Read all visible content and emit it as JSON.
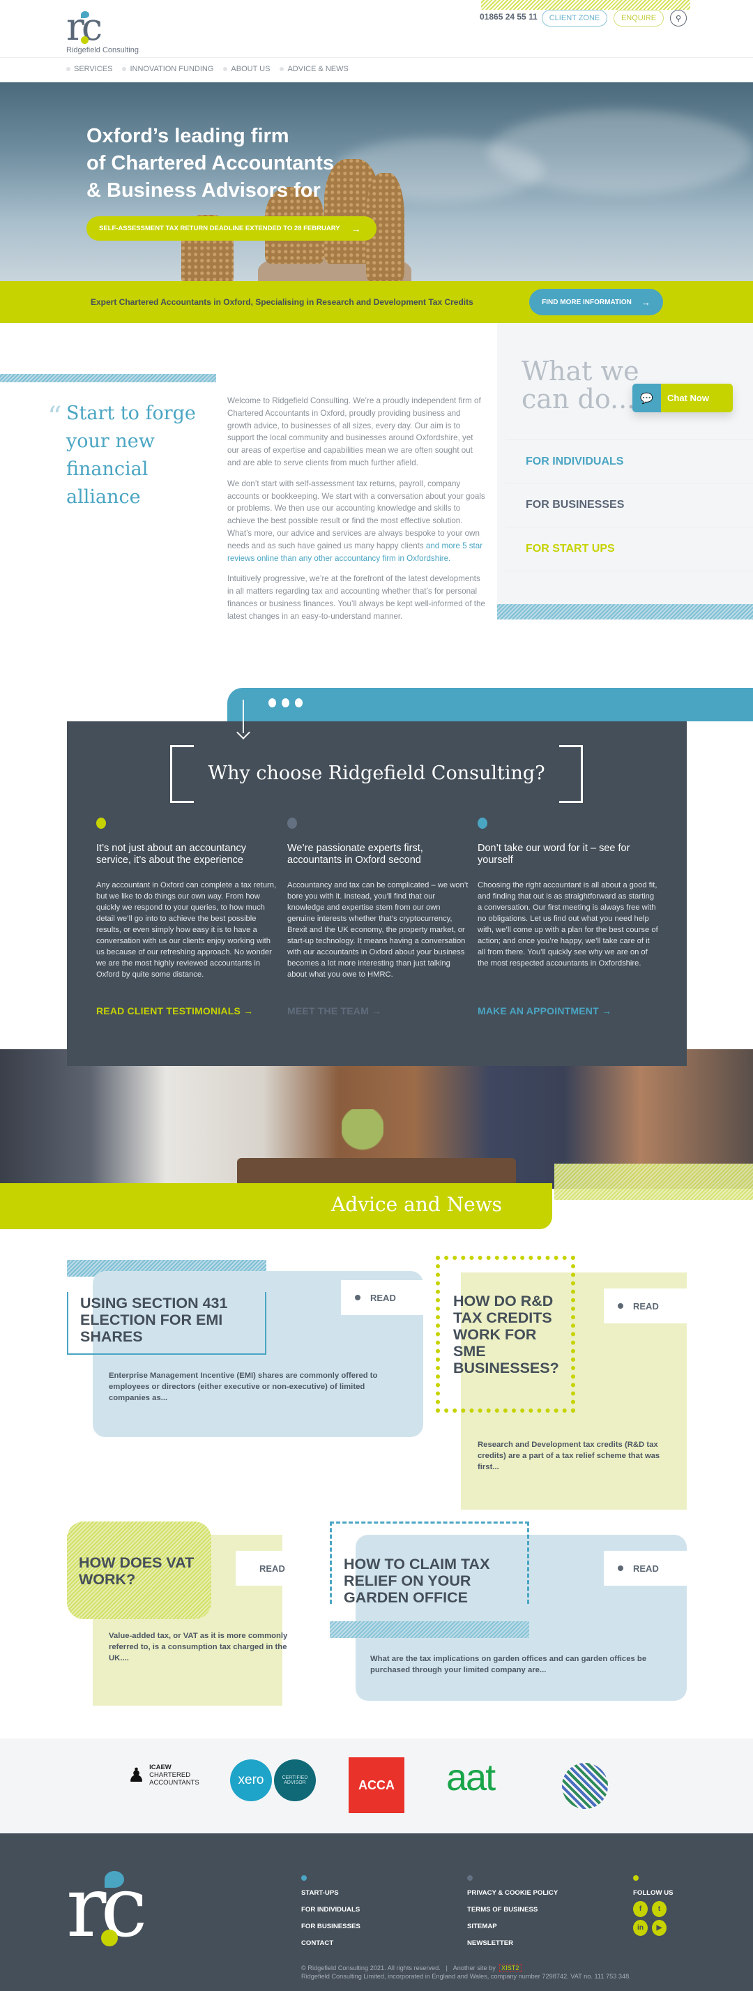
{
  "header": {
    "logo_text": "Ridgefield Consulting",
    "logo_mark": "rc",
    "phone": "01865 24 55 11",
    "client_zone": "CLIENT ZONE",
    "enquire": "ENQUIRE",
    "search_icon": "search-icon"
  },
  "nav": [
    {
      "label": "SERVICES"
    },
    {
      "label": "INNOVATION FUNDING"
    },
    {
      "label": "ABOUT US"
    },
    {
      "label": "ADVICE & NEWS"
    }
  ],
  "hero": {
    "title_lines": [
      "Oxford’s leading firm",
      "of Chartered Accountants",
      "& Business Advisors for"
    ],
    "cta": "SELF-ASSESSMENT TAX RETURN DEADLINE EXTENDED TO 28 FEBRUARY",
    "cta_arrow": "→"
  },
  "band": {
    "text": "Expert Chartered Accountants in Oxford, Specialising in Research and Development Tax Credits",
    "button": "FIND MORE INFORMATION",
    "arrow": "→"
  },
  "intro": {
    "quote_mark": "“",
    "quote": "Start to forge your new financial alliance",
    "p1": "Welcome to Ridgefield Consulting. We’re a proudly independent firm of Chartered Accountants in Oxford, proudly providing business and growth advice, to businesses of all sizes, every day. Our aim is to support the local community and businesses around Oxfordshire, yet our areas of expertise and capabilities mean we are often sought out and are able to serve clients from much further afield.",
    "p2": "We don’t start with self-assessment tax returns, payroll, company accounts or bookkeeping. We start with a conversation about your goals or problems. We then use our accounting knowledge and skills to achieve the best possible result or find the most effective solution. What’s more, our advice and services are always bespoke to your own needs and as such have gained us many happy clients ",
    "p2_link": "and more 5 star reviews online than any other accountancy firm in Oxfordshire.",
    "p3": "Intuitively progressive, we’re at the forefront of the latest developments in all matters regarding tax and accounting whether that’s for personal finances or business finances. You’ll always be kept well-informed of the latest changes in an easy-to-understand manner."
  },
  "what_we_do": {
    "title": "What we can do...",
    "items": [
      {
        "label": "FOR INDIVIDUALS",
        "color": "#4aa5c3"
      },
      {
        "label": "FOR BUSINESSES",
        "color": "#5a6676"
      },
      {
        "label": "FOR START UPS",
        "color": "#c6d300"
      }
    ]
  },
  "chat": {
    "label": "Chat Now",
    "icon": "chat-icon"
  },
  "why": {
    "title": "Why choose Ridgefield Consulting?",
    "columns": [
      {
        "dot_color": "#c6d300",
        "heading": "It’s not just about an accountancy service, it’s about the experience",
        "body": "Any accountant in Oxford can complete a tax return, but we like to do things our own way. From how quickly we respond to your queries, to how much detail we’ll go into to achieve the best possible results, or even simply how easy it is to have a conversation with us our clients enjoy working with us because of our refreshing approach. No wonder we are the most highly reviewed accountants in Oxford by quite some distance.",
        "link": "READ CLIENT TESTIMONIALS →",
        "link_color": "#c6d300"
      },
      {
        "dot_color": "#637183",
        "heading": "We’re passionate experts first, accountants in Oxford second",
        "body": "Accountancy and tax can be complicated – we won’t bore you with it. Instead, you’ll find that our knowledge and expertise stem from our own genuine interests whether that’s cryptocurrency, Brexit and the UK economy, the property market, or start-up technology. It means having a conversation with our accountants in Oxford about your business becomes a lot more interesting than just talking about what you owe to HMRC.",
        "link": "MEET THE TEAM →",
        "link_color": "#5f6c7b"
      },
      {
        "dot_color": "#4aa5c3",
        "heading": "Don’t take our word for it – see for yourself",
        "body": "Choosing the right accountant is all about a good fit, and finding that out is as straightforward as starting a conversation. Our first meeting is always free with no obligations. Let us find out what you need help with, we’ll come up with a plan for the best course of action; and once you’re happy, we’ll take care of it all from there. You’ll quickly see why we are on of the most respected accountants in Oxfordshire.",
        "link": "MAKE AN APPOINTMENT →",
        "link_color": "#4aa5c3"
      }
    ]
  },
  "advice": {
    "title": "Advice and News",
    "read_label": "READ",
    "cards": [
      {
        "title": "USING SECTION 431 ELECTION FOR EMI SHARES",
        "excerpt": "Enterprise Management Incentive (EMI) shares are commonly offered to employees or directors (either executive or non-executive) of limited companies as..."
      },
      {
        "title": "HOW DO R&D TAX CREDITS WORK FOR SME BUSINESSES?",
        "excerpt": "Research and Development tax credits (R&D tax credits) are a part of a tax relief scheme that was first..."
      },
      {
        "title": "HOW DOES VAT WORK?",
        "excerpt": "Value-added tax, or VAT as it is more commonly referred to, is a consumption tax charged in the UK...."
      },
      {
        "title": "HOW TO CLAIM TAX RELIEF ON YOUR GARDEN OFFICE",
        "excerpt": "What are the tax implications on garden offices and can garden offices be purchased through your limited company are..."
      }
    ]
  },
  "partners": {
    "icaew": [
      "ICAEW",
      "CHARTERED",
      "ACCOUNTANTS"
    ],
    "xero": "xero",
    "xero_badge": "CERTIFIED ADVISOR",
    "acca": "ACCA",
    "aat": "aat"
  },
  "footer": {
    "col1": [
      "START-UPS",
      "FOR INDIVIDUALS",
      "FOR BUSINESSES",
      "CONTACT"
    ],
    "col2": [
      "PRIVACY & COOKIE POLICY",
      "TERMS OF BUSINESS",
      "SITEMAP",
      "NEWSLETTER"
    ],
    "follow": "FOLLOW US",
    "social": [
      {
        "icon": "facebook-icon",
        "glyph": "f"
      },
      {
        "icon": "twitter-icon",
        "glyph": "t"
      },
      {
        "icon": "linkedin-icon",
        "glyph": "in"
      },
      {
        "icon": "youtube-icon",
        "glyph": "▶"
      }
    ],
    "copyright": "© Ridgefield Consulting 2021. All rights reserved.",
    "separator": "|",
    "another_site": "Another site by",
    "agency": "XIST2",
    "company_info": "Ridgefield Consulting Limited, incorporated in England and Wales, company number 7298742. VAT no. 111 753 348."
  }
}
